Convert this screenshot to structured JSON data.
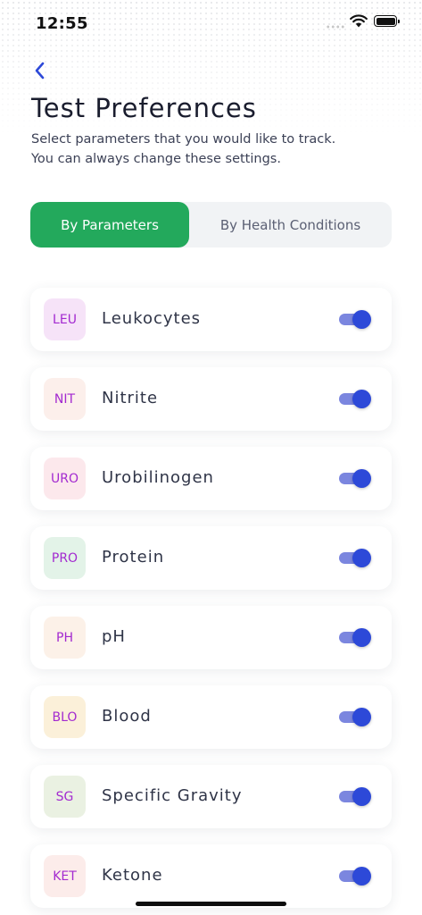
{
  "status_bar": {
    "time": "12:55"
  },
  "header": {
    "title": "Test Preferences",
    "subtitle_line1": "Select parameters that you would like to track.",
    "subtitle_line2": "You can always change these settings."
  },
  "tabs": [
    {
      "label": "By Parameters",
      "selected": true
    },
    {
      "label": "By Health Conditions",
      "selected": false
    }
  ],
  "colors": {
    "accent_green": "#23a95c",
    "toggle_knob": "#2d49d8",
    "toggle_track": "#7b86df",
    "badge_text": "#a32ad0"
  },
  "parameters": [
    {
      "code": "LEU",
      "name": "Leukocytes",
      "badge_bg": "#f6e3f8",
      "enabled": true
    },
    {
      "code": "NIT",
      "name": "Nitrite",
      "badge_bg": "#fcefeb",
      "enabled": true
    },
    {
      "code": "URO",
      "name": "Urobilinogen",
      "badge_bg": "#fce8ec",
      "enabled": true
    },
    {
      "code": "PRO",
      "name": "Protein",
      "badge_bg": "#e3f3e8",
      "enabled": true
    },
    {
      "code": "PH",
      "name": "pH",
      "badge_bg": "#fcf1e8",
      "enabled": true
    },
    {
      "code": "BLO",
      "name": "Blood",
      "badge_bg": "#fbf0d9",
      "enabled": true
    },
    {
      "code": "SG",
      "name": "Specific Gravity",
      "badge_bg": "#eaf1e2",
      "enabled": true
    },
    {
      "code": "KET",
      "name": "Ketone",
      "badge_bg": "#fcecea",
      "enabled": true
    }
  ]
}
